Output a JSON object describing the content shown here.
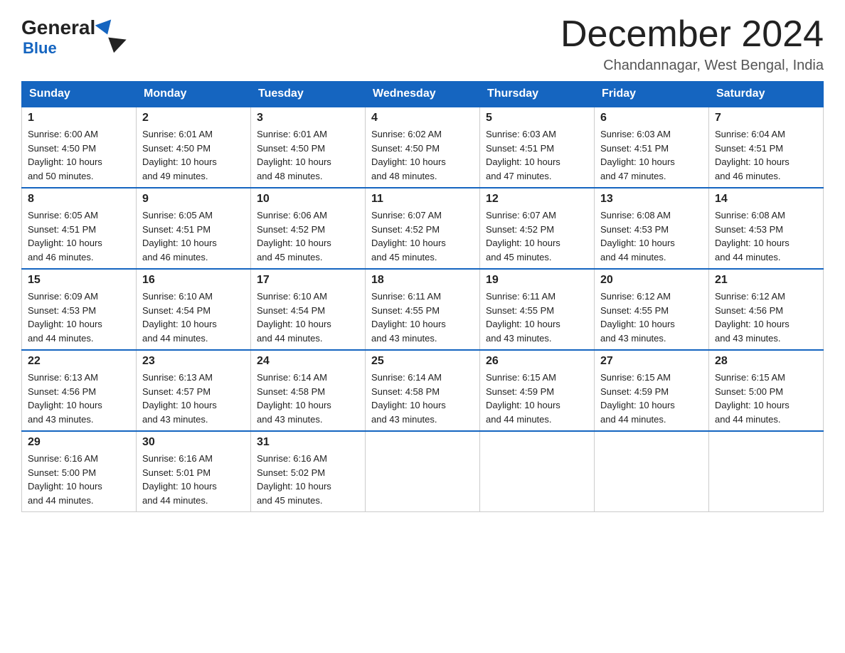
{
  "logo": {
    "general": "General",
    "triangle": "",
    "blue": "Blue"
  },
  "header": {
    "month_title": "December 2024",
    "location": "Chandannagar, West Bengal, India"
  },
  "days_of_week": [
    "Sunday",
    "Monday",
    "Tuesday",
    "Wednesday",
    "Thursday",
    "Friday",
    "Saturday"
  ],
  "weeks": [
    [
      {
        "day": "1",
        "sunrise": "6:00 AM",
        "sunset": "4:50 PM",
        "daylight": "10 hours and 50 minutes."
      },
      {
        "day": "2",
        "sunrise": "6:01 AM",
        "sunset": "4:50 PM",
        "daylight": "10 hours and 49 minutes."
      },
      {
        "day": "3",
        "sunrise": "6:01 AM",
        "sunset": "4:50 PM",
        "daylight": "10 hours and 48 minutes."
      },
      {
        "day": "4",
        "sunrise": "6:02 AM",
        "sunset": "4:50 PM",
        "daylight": "10 hours and 48 minutes."
      },
      {
        "day": "5",
        "sunrise": "6:03 AM",
        "sunset": "4:51 PM",
        "daylight": "10 hours and 47 minutes."
      },
      {
        "day": "6",
        "sunrise": "6:03 AM",
        "sunset": "4:51 PM",
        "daylight": "10 hours and 47 minutes."
      },
      {
        "day": "7",
        "sunrise": "6:04 AM",
        "sunset": "4:51 PM",
        "daylight": "10 hours and 46 minutes."
      }
    ],
    [
      {
        "day": "8",
        "sunrise": "6:05 AM",
        "sunset": "4:51 PM",
        "daylight": "10 hours and 46 minutes."
      },
      {
        "day": "9",
        "sunrise": "6:05 AM",
        "sunset": "4:51 PM",
        "daylight": "10 hours and 46 minutes."
      },
      {
        "day": "10",
        "sunrise": "6:06 AM",
        "sunset": "4:52 PM",
        "daylight": "10 hours and 45 minutes."
      },
      {
        "day": "11",
        "sunrise": "6:07 AM",
        "sunset": "4:52 PM",
        "daylight": "10 hours and 45 minutes."
      },
      {
        "day": "12",
        "sunrise": "6:07 AM",
        "sunset": "4:52 PM",
        "daylight": "10 hours and 45 minutes."
      },
      {
        "day": "13",
        "sunrise": "6:08 AM",
        "sunset": "4:53 PM",
        "daylight": "10 hours and 44 minutes."
      },
      {
        "day": "14",
        "sunrise": "6:08 AM",
        "sunset": "4:53 PM",
        "daylight": "10 hours and 44 minutes."
      }
    ],
    [
      {
        "day": "15",
        "sunrise": "6:09 AM",
        "sunset": "4:53 PM",
        "daylight": "10 hours and 44 minutes."
      },
      {
        "day": "16",
        "sunrise": "6:10 AM",
        "sunset": "4:54 PM",
        "daylight": "10 hours and 44 minutes."
      },
      {
        "day": "17",
        "sunrise": "6:10 AM",
        "sunset": "4:54 PM",
        "daylight": "10 hours and 44 minutes."
      },
      {
        "day": "18",
        "sunrise": "6:11 AM",
        "sunset": "4:55 PM",
        "daylight": "10 hours and 43 minutes."
      },
      {
        "day": "19",
        "sunrise": "6:11 AM",
        "sunset": "4:55 PM",
        "daylight": "10 hours and 43 minutes."
      },
      {
        "day": "20",
        "sunrise": "6:12 AM",
        "sunset": "4:55 PM",
        "daylight": "10 hours and 43 minutes."
      },
      {
        "day": "21",
        "sunrise": "6:12 AM",
        "sunset": "4:56 PM",
        "daylight": "10 hours and 43 minutes."
      }
    ],
    [
      {
        "day": "22",
        "sunrise": "6:13 AM",
        "sunset": "4:56 PM",
        "daylight": "10 hours and 43 minutes."
      },
      {
        "day": "23",
        "sunrise": "6:13 AM",
        "sunset": "4:57 PM",
        "daylight": "10 hours and 43 minutes."
      },
      {
        "day": "24",
        "sunrise": "6:14 AM",
        "sunset": "4:58 PM",
        "daylight": "10 hours and 43 minutes."
      },
      {
        "day": "25",
        "sunrise": "6:14 AM",
        "sunset": "4:58 PM",
        "daylight": "10 hours and 43 minutes."
      },
      {
        "day": "26",
        "sunrise": "6:15 AM",
        "sunset": "4:59 PM",
        "daylight": "10 hours and 44 minutes."
      },
      {
        "day": "27",
        "sunrise": "6:15 AM",
        "sunset": "4:59 PM",
        "daylight": "10 hours and 44 minutes."
      },
      {
        "day": "28",
        "sunrise": "6:15 AM",
        "sunset": "5:00 PM",
        "daylight": "10 hours and 44 minutes."
      }
    ],
    [
      {
        "day": "29",
        "sunrise": "6:16 AM",
        "sunset": "5:00 PM",
        "daylight": "10 hours and 44 minutes."
      },
      {
        "day": "30",
        "sunrise": "6:16 AM",
        "sunset": "5:01 PM",
        "daylight": "10 hours and 44 minutes."
      },
      {
        "day": "31",
        "sunrise": "6:16 AM",
        "sunset": "5:02 PM",
        "daylight": "10 hours and 45 minutes."
      },
      null,
      null,
      null,
      null
    ]
  ],
  "labels": {
    "sunrise": "Sunrise:",
    "sunset": "Sunset:",
    "daylight": "Daylight:"
  }
}
